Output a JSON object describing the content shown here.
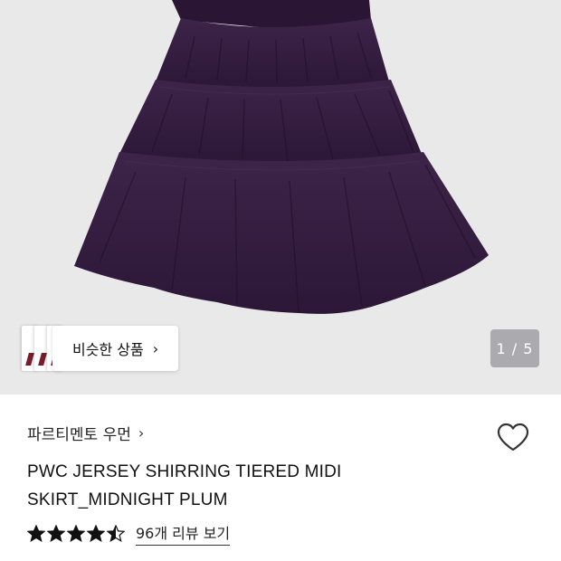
{
  "similar_products": {
    "label": "비슷한 상품",
    "chevron": "›",
    "icon": "chevron-right-icon"
  },
  "pager": {
    "current": 1,
    "total": 5,
    "text": "1 / 5"
  },
  "product": {
    "brand": "파르티멘토 우먼",
    "brand_chevron": "›",
    "title": "PWC JERSEY SHIRRING TIERED MIDI SKIRT_MIDNIGHT PLUM",
    "rating": 4.5,
    "review_link": "96개 리뷰 보기"
  },
  "icons": {
    "wishlist": "heart-outline-icon",
    "star": "star-icon"
  },
  "colors": {
    "hero_bg": "#e9e9ea",
    "skirt": "#3a2147",
    "skirt_shadow": "#24122e",
    "star": "#111111"
  }
}
